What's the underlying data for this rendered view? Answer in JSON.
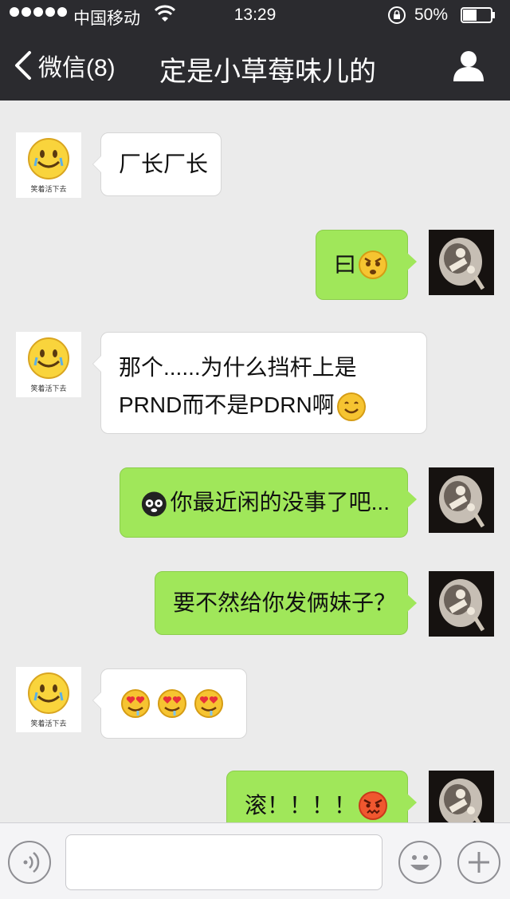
{
  "status_bar": {
    "carrier": "中国移动",
    "time": "13:29",
    "battery": "50%",
    "battery_level": 0.5
  },
  "nav": {
    "back_label": "微信(8)",
    "title": "定是小草莓味儿的"
  },
  "contact_avatar_caption": "笑着活下去",
  "messages": [
    {
      "side": "left",
      "text": "厂长厂长"
    },
    {
      "side": "right",
      "text": "曰",
      "emoji_after": [
        "angry-face-icon"
      ]
    },
    {
      "side": "left",
      "lines": [
        "那个......为什么挡杆上是",
        "PRND而不是PDRN啊"
      ],
      "emoji_after": [
        "smile-emoji-icon"
      ]
    },
    {
      "side": "right",
      "emoji_before": [
        "bomb-face-icon"
      ],
      "text": "你最近闲的没事了吧..."
    },
    {
      "side": "right",
      "text": "要不然给你发俩妹子？"
    },
    {
      "side": "left",
      "emoji_only": [
        "heart-eyes-drool-icon",
        "heart-eyes-drool-icon",
        "heart-eyes-drool-icon"
      ]
    },
    {
      "side": "right",
      "text": "滚！！！！",
      "emoji_after": [
        "furious-face-icon"
      ]
    }
  ],
  "colors": {
    "bar_dark": "#2b2b2f",
    "chat_bg": "#ebebeb",
    "bubble_green": "#a0e75a",
    "bubble_white": "#ffffff"
  },
  "input_bar": {
    "voice_icon": "voice-icon",
    "emoji_icon": "emoji-icon",
    "plus_icon": "plus-icon",
    "input_value": ""
  }
}
